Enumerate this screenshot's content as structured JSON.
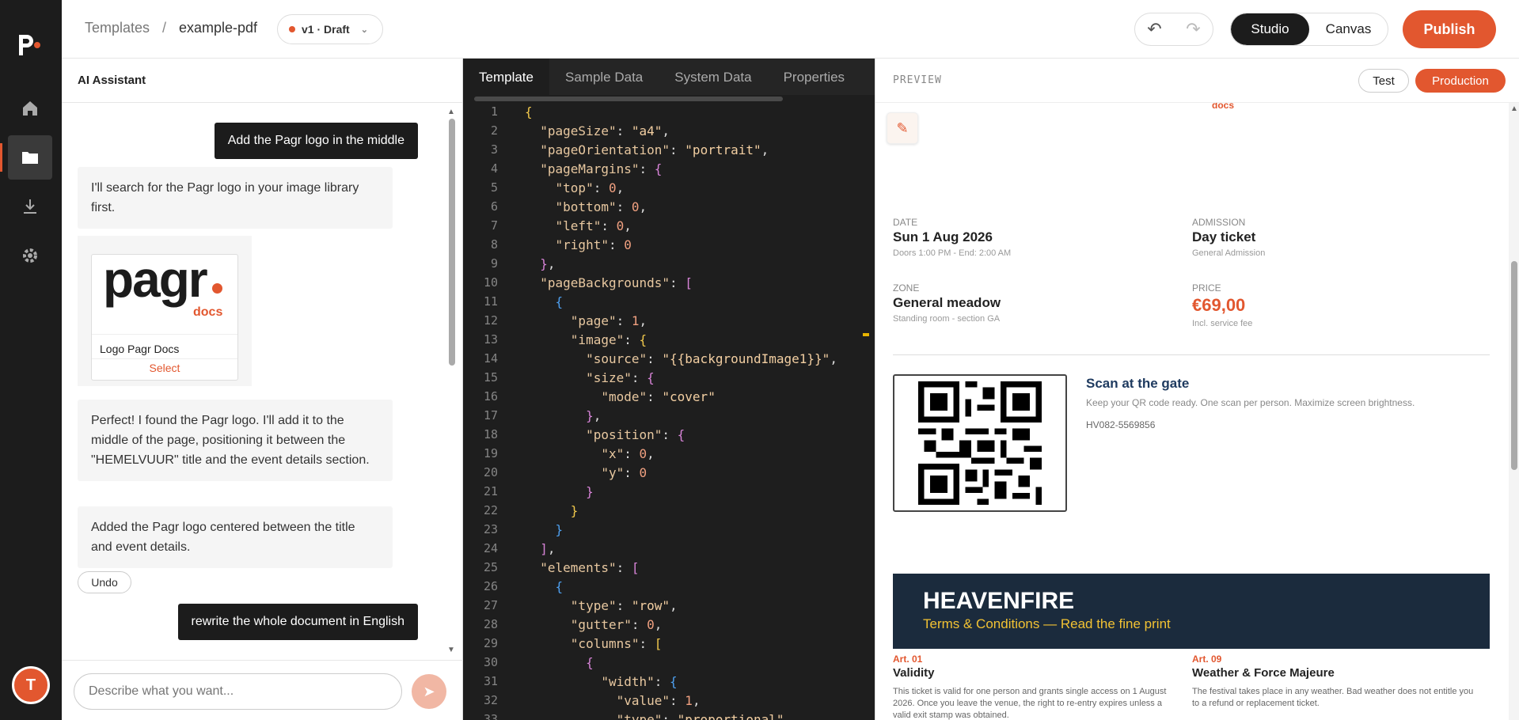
{
  "app": {
    "avatar_initial": "T",
    "accent": "#e2572f"
  },
  "rail": {
    "items": [
      "home-icon",
      "folder-icon",
      "download-icon",
      "gear-icon"
    ],
    "active": 1
  },
  "header": {
    "breadcrumb_root": "Templates",
    "breadcrumb_sep": "/",
    "breadcrumb_current": "example-pdf",
    "version_label": "v1 · Draft",
    "mode_studio": "Studio",
    "mode_canvas": "Canvas",
    "publish_label": "Publish"
  },
  "assistant": {
    "title": "AI Assistant",
    "messages": {
      "u1": "Add the Pagr logo in the middle",
      "a1": "I'll search for the Pagr logo in your image library first.",
      "a2": "Perfect! I found the Pagr logo. I'll add it to the middle of the page, positioning it between the \"HEMELVUUR\" title and the event details section.",
      "a3": "Added the Pagr logo centered between the title and event details.",
      "u2": "rewrite the whole document in English"
    },
    "logo_card": {
      "wordmark": "pagr",
      "sub": "docs",
      "name": "Logo Pagr Docs",
      "select": "Select"
    },
    "undo": "Undo",
    "composer_placeholder": "Describe what you want..."
  },
  "editor": {
    "tabs": [
      "Template",
      "Sample Data",
      "System Data",
      "Properties"
    ],
    "active_tab": 0
  },
  "preview": {
    "label": "PREVIEW",
    "test": "Test",
    "production": "Production",
    "docs_small": "docs",
    "date": {
      "label": "DATE",
      "value": "Sun 1 Aug 2026",
      "sub": "Doors 1:00 PM - End: 2:00 AM"
    },
    "admission": {
      "label": "ADMISSION",
      "value": "Day ticket",
      "sub": "General Admission"
    },
    "zone": {
      "label": "ZONE",
      "value": "General meadow",
      "sub": "Standing room - section GA"
    },
    "price": {
      "label": "PRICE",
      "value": "€69,00",
      "sub": "Incl. service fee"
    },
    "scan_title": "Scan at the gate",
    "scan_desc": "Keep your QR code ready. One scan per person. Maximize screen brightness.",
    "scan_code": "HV082-5569856",
    "band_title": "HEAVENFIRE",
    "band_sub": "Terms & Conditions — Read the fine print",
    "art1": {
      "num": "Art. 01",
      "title": "Validity",
      "body": "This ticket is valid for one person and grants single access on 1 August 2026. Once you leave the venue, the right to re-entry expires unless a valid exit stamp was obtained."
    },
    "art2": {
      "num": "Art. 09",
      "title": "Weather & Force Majeure",
      "body": "The festival takes place in any weather. Bad weather does not entitle you to a refund or replacement ticket."
    }
  }
}
